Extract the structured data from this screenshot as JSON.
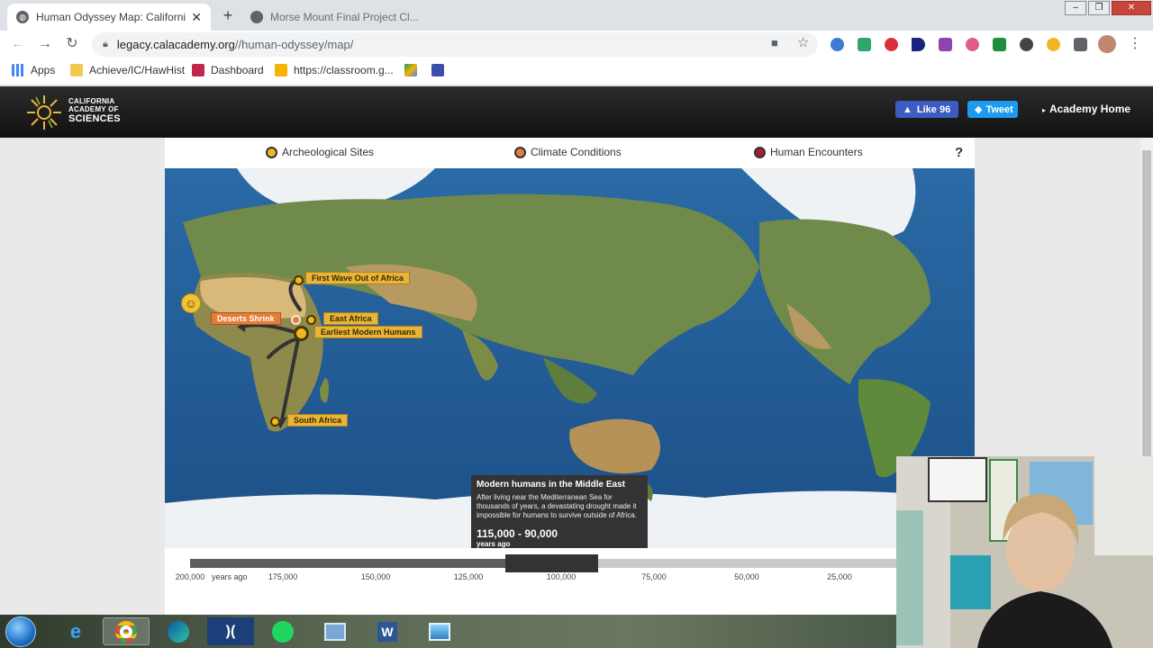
{
  "browser": {
    "tabs": [
      {
        "title": "Human Odyssey Map: California",
        "active": true
      },
      {
        "title": "Morse Mount Final Project Cl...",
        "active": false
      }
    ],
    "url_host": "legacy.calacademy.org",
    "url_path": "//human-odyssey/map/",
    "bookmarks": [
      "Apps",
      "Achieve/IC/HawHist",
      "Dashboard",
      "https://classroom.g..."
    ]
  },
  "site": {
    "logo_line1": "CALIFORNIA",
    "logo_line2": "ACADEMY OF",
    "logo_line3": "SCIENCES",
    "fb_like": "Like 96",
    "tweet": "Tweet",
    "academy_home": "Academy Home"
  },
  "legend": {
    "items": [
      {
        "label": "Archeological Sites",
        "color": "#f2b625"
      },
      {
        "label": "Climate Conditions",
        "color": "#e47c3a"
      },
      {
        "label": "Human Encounters",
        "color": "#b0183a"
      }
    ],
    "help": "?"
  },
  "map": {
    "markers": [
      {
        "label": "First Wave Out of Africa",
        "type": "archeological"
      },
      {
        "label": "East Africa",
        "type": "archeological"
      },
      {
        "label": "Earliest Modern Humans",
        "type": "archeological"
      },
      {
        "label": "South Africa",
        "type": "archeological"
      },
      {
        "label": "Deserts Shrink",
        "type": "climate"
      }
    ],
    "tooltip": {
      "title": "Modern humans in the Middle East",
      "body": "After living near the Mediterranean Sea for thousands of years, a devastating drought made it impossible for humans to survive outside of Africa.",
      "range": "115,000 - 90,000",
      "unit": "years ago"
    }
  },
  "timeline": {
    "start_label": "200,000",
    "years_ago": "years ago",
    "ticks": [
      "175,000",
      "150,000",
      "125,000",
      "100,000",
      "75,000",
      "50,000",
      "25,000"
    ],
    "window_start": 115000,
    "window_end": 90000,
    "colors": {
      "past": "#5e5e5e",
      "window": "#333333",
      "future": "#c9c9c9"
    }
  }
}
